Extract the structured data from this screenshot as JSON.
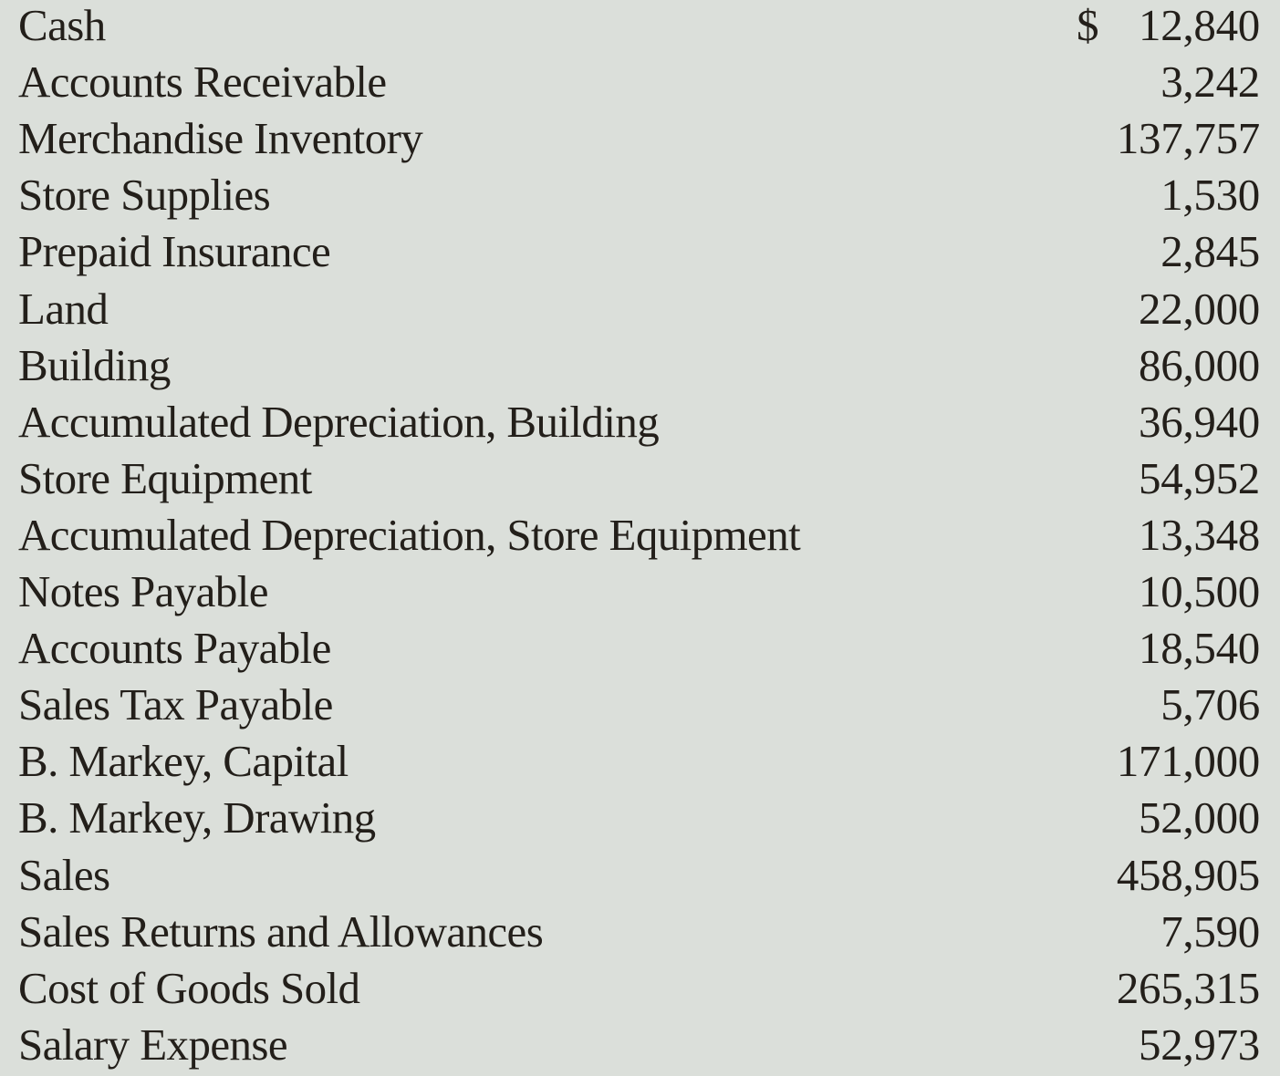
{
  "accounts": [
    {
      "name": "Cash",
      "currency": "$",
      "amount": "12,840"
    },
    {
      "name": "Accounts Receivable",
      "currency": "",
      "amount": "3,242"
    },
    {
      "name": "Merchandise Inventory",
      "currency": "",
      "amount": "137,757"
    },
    {
      "name": "Store Supplies",
      "currency": "",
      "amount": "1,530"
    },
    {
      "name": "Prepaid Insurance",
      "currency": "",
      "amount": "2,845"
    },
    {
      "name": "Land",
      "currency": "",
      "amount": "22,000"
    },
    {
      "name": "Building",
      "currency": "",
      "amount": "86,000"
    },
    {
      "name": "Accumulated Depreciation, Building",
      "currency": "",
      "amount": "36,940"
    },
    {
      "name": "Store Equipment",
      "currency": "",
      "amount": "54,952"
    },
    {
      "name": "Accumulated Depreciation, Store Equipment",
      "currency": "",
      "amount": "13,348"
    },
    {
      "name": "Notes Payable",
      "currency": "",
      "amount": "10,500"
    },
    {
      "name": "Accounts Payable",
      "currency": "",
      "amount": "18,540"
    },
    {
      "name": "Sales Tax Payable",
      "currency": "",
      "amount": "5,706"
    },
    {
      "name": "B. Markey, Capital",
      "currency": "",
      "amount": "171,000"
    },
    {
      "name": "B. Markey, Drawing",
      "currency": "",
      "amount": "52,000"
    },
    {
      "name": "Sales",
      "currency": "",
      "amount": "458,905"
    },
    {
      "name": "Sales Returns and Allowances",
      "currency": "",
      "amount": "7,590"
    },
    {
      "name": "Cost of Goods Sold",
      "currency": "",
      "amount": "265,315"
    },
    {
      "name": "Salary Expense",
      "currency": "",
      "amount": "52,973"
    }
  ],
  "colors": {
    "background": "#dbdfda",
    "text": "#231f1a"
  }
}
